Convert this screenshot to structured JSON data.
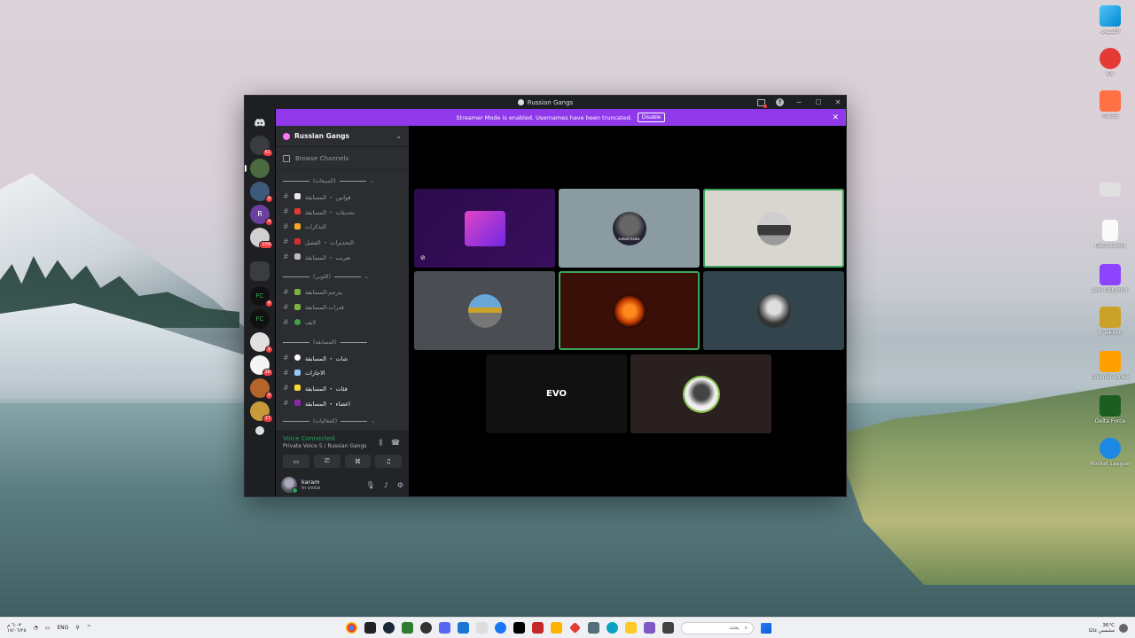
{
  "window": {
    "title": "Russian Gangs"
  },
  "banner": {
    "text": "Streamer Mode is enabled. Usernames have been truncated.",
    "button": "Disable"
  },
  "server": {
    "name": "Russian Gangs",
    "browse": "Browse Channels"
  },
  "rail": {
    "badges": [
      "61",
      "9",
      "4",
      "104",
      "4",
      "1",
      "16",
      "9",
      "17"
    ]
  },
  "channels": {
    "cat1": "(المبيعات)",
    "cat2": "(اللوبي)",
    "cat3": "(المسابقة)",
    "cat4": "(الفعاليات)",
    "items": [
      "قوانين ・ المسابقة",
      "تحديثات ・ المسابقة",
      "التذكرات",
      "التحذيرات ・ الفصل",
      "تعريب ・ المسابقة",
      "يترجم-المسابقة",
      "قدرات-المسابقة",
      "لايف",
      "شات ・ المسابقة",
      "الاجازات",
      "فئات ・ المسابقة",
      "اعضاء ・ المسابقة"
    ]
  },
  "voice": {
    "status": "Voice Connected",
    "channel": "Private Voice 5 / Russian Gangs"
  },
  "user": {
    "name": "karam",
    "state": "In voice"
  },
  "tiles": {
    "t2_text": "KARAM HABIB",
    "t7_text": "EVO"
  },
  "desktop": {
    "icons": [
      "الكمبيوتر",
      "EA",
      "Fire36",
      "",
      "Documents",
      "Logi Options+",
      "8 Tekken",
      "Counter-Strike 2",
      "Delta Force",
      "Rocket League"
    ]
  },
  "taskbar": {
    "lang": "ENG",
    "time": "٦:٠٣ م",
    "date": "١٧/٠٦/٢٥",
    "search_placeholder": "بحث",
    "weather": "36°C",
    "weather_desc": "مشمس غالبًا"
  },
  "colors": {
    "accent": "#8f39ea",
    "voice_green": "#23a55a",
    "speaking_border": "#3ba55d"
  }
}
